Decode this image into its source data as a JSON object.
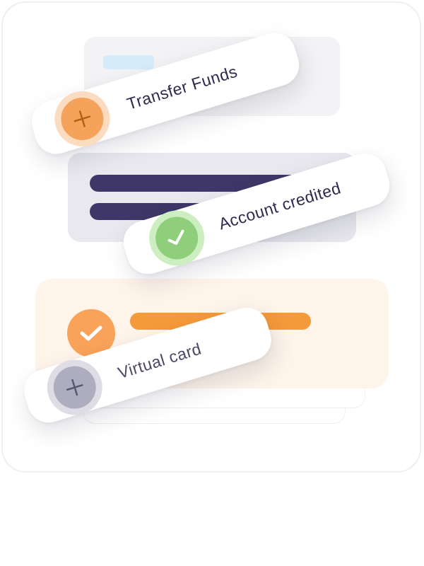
{
  "cards": {
    "transfer": {
      "label": "Transfer Funds",
      "icon": "plus-icon",
      "accent_color": "#f5a25a"
    },
    "credited": {
      "label": "Account credited",
      "icon": "check-icon",
      "accent_color": "#8fce7a"
    },
    "virtual": {
      "label": "Virtual card",
      "icon": "plus-icon",
      "accent_color": "#aeadbf"
    }
  },
  "panels": {
    "orange_item": {
      "icon": "check-icon",
      "accent_color": "#f59a3a"
    },
    "dark_bar_color": "#3f3767"
  }
}
